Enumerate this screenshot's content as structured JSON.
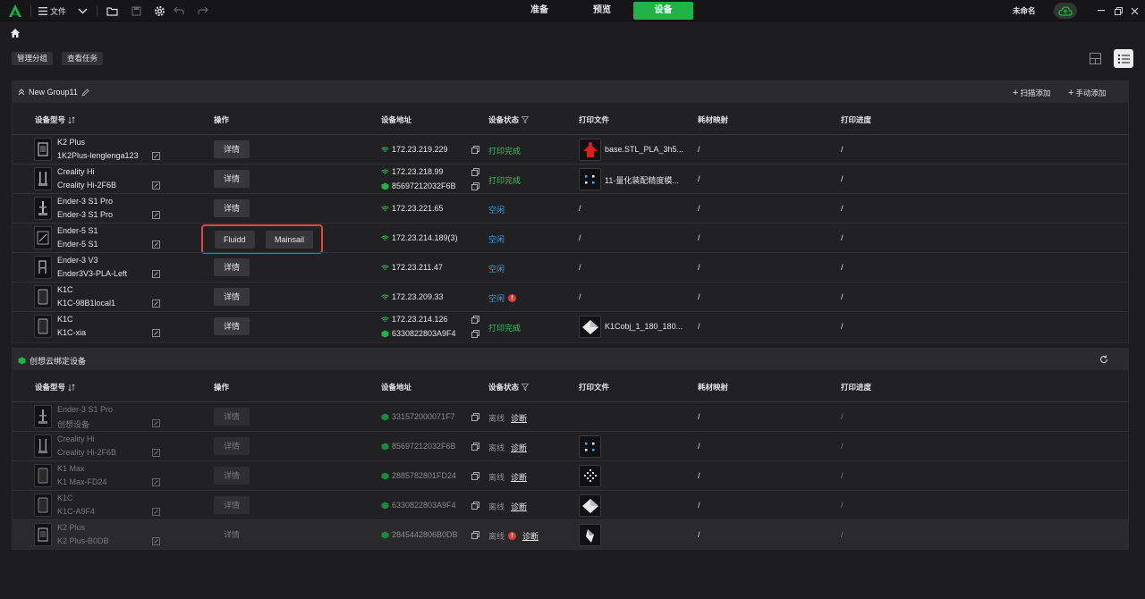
{
  "topbar": {
    "file_menu_label": "文件",
    "tabs": [
      {
        "label": "准备",
        "active": false
      },
      {
        "label": "预览",
        "active": false
      },
      {
        "label": "设备",
        "active": true
      }
    ],
    "user_name": "未命名",
    "accent_color": "#1fb24a"
  },
  "toolbar": {
    "manage_groups_label": "管理分组",
    "view_tasks_label": "查看任务"
  },
  "columns": {
    "model": "设备型号",
    "operation": "操作",
    "address": "设备地址",
    "status": "设备状态",
    "file": "打印文件",
    "material": "耗材映射",
    "progress": "打印进度"
  },
  "group1": {
    "title": "New Group11",
    "scan_add": "扫描添加",
    "manual_add": "手动添加",
    "rows": [
      {
        "model": "K2 Plus",
        "name": "1K2Plus-lenglenga123",
        "op": "详情",
        "ip": "172.23.219.229",
        "serial": "",
        "status": "打印完成",
        "status_type": "done",
        "file": "base.STL_PLA_3h5...",
        "material": "/",
        "progress": "/"
      },
      {
        "model": "Creality Hi",
        "name": "Creality Hi-2F6B",
        "op": "详情",
        "ip": "172.23.218.99",
        "serial": "85697212032F6B",
        "status": "打印完成",
        "status_type": "done",
        "file": "11-量化装配精度模...",
        "material": "/",
        "progress": "/"
      },
      {
        "model": "Ender-3 S1 Pro",
        "name": "Ender-3 S1 Pro",
        "op": "详情",
        "ip": "172.23.221.65",
        "serial": "",
        "status": "空闲",
        "status_type": "idle",
        "file": "/",
        "material": "/",
        "progress": "/"
      },
      {
        "model": "Ender-5 S1",
        "name": "Ender-5 S1",
        "op_fluidd": "Fluidd",
        "op_mainsail": "Mainsail",
        "ip": "172.23.214.189(3)",
        "serial": "",
        "status": "空闲",
        "status_type": "idle",
        "file": "/",
        "material": "/",
        "progress": "/"
      },
      {
        "model": "Ender-3 V3",
        "name": "Ender3V3-PLA-Left",
        "op": "详情",
        "ip": "172.23.211.47",
        "serial": "",
        "status": "空闲",
        "status_type": "idle",
        "file": "/",
        "material": "/",
        "progress": "/"
      },
      {
        "model": "K1C",
        "name": "K1C-98B1local1",
        "op": "详情",
        "ip": "172.23.209.33",
        "serial": "",
        "status": "空闲",
        "status_type": "idle",
        "error_mark": "!",
        "file": "/",
        "material": "/",
        "progress": "/"
      },
      {
        "model": "K1C",
        "name": "K1C-xia",
        "op": "详情",
        "ip": "172.23.214.126",
        "serial": "6330822803A9F4",
        "status": "打印完成",
        "status_type": "done",
        "file": "K1Cobj_1_180_180...",
        "material": "/",
        "progress": "/"
      }
    ]
  },
  "group2": {
    "title": "创想云绑定设备",
    "rows": [
      {
        "model": "Ender-3 S1 Pro",
        "name": "创想设备",
        "op": "详情",
        "serial": "331572000071F7",
        "status": "离线",
        "diag": "诊断",
        "material": "/",
        "progress": "/"
      },
      {
        "model": "Creality Hi",
        "name": "Creality Hi-2F6B",
        "op": "详情",
        "serial": "85697212032F6B",
        "status": "离线",
        "diag": "诊断",
        "material": "/",
        "progress": "/"
      },
      {
        "model": "K1 Max",
        "name": "K1 Max-FD24",
        "op": "详情",
        "serial": "2885782801FD24",
        "status": "离线",
        "diag": "诊断",
        "material": "/",
        "progress": "/"
      },
      {
        "model": "K1C",
        "name": "K1C-A9F4",
        "op": "详情",
        "serial": "6330822803A9F4",
        "status": "离线",
        "diag": "诊断",
        "material": "/",
        "progress": "/"
      },
      {
        "model": "K2 Plus",
        "name": "K2 Plus-B0DB",
        "op": "详情",
        "serial": "2845442806B0DB",
        "status": "离线",
        "error_mark": "!",
        "diag": "诊断",
        "material": "/",
        "progress": "/"
      }
    ]
  }
}
